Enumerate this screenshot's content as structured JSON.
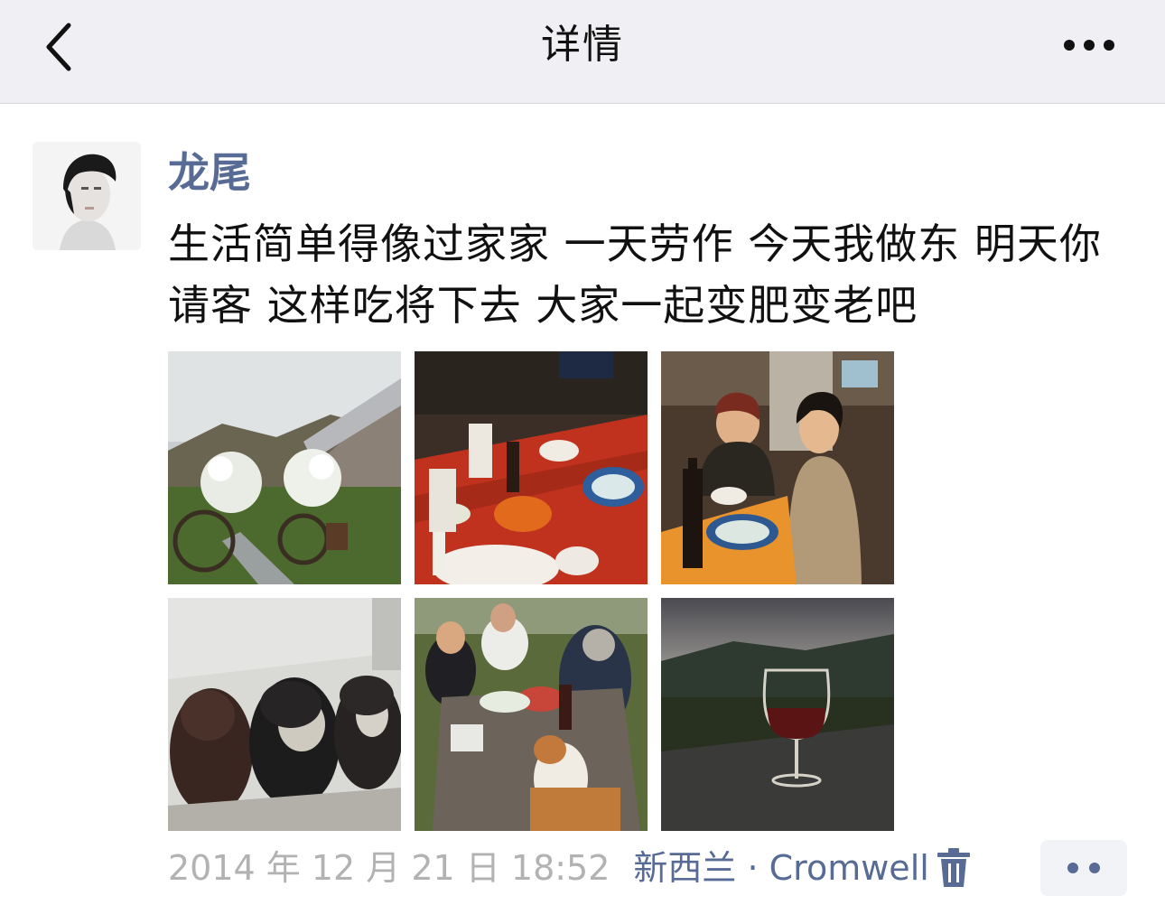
{
  "header": {
    "title": "详情",
    "back_icon": "chevron-left-icon",
    "more_icon": "more-dots-icon"
  },
  "post": {
    "author": "龙尾",
    "text": "生活简单得像过家家 一天劳作 今天我做东 明天你请客 这样吃将下去 大家一起变肥变老吧",
    "photos": [
      {
        "name": "photo-garden-house"
      },
      {
        "name": "photo-dinner-table"
      },
      {
        "name": "photo-friends-dinner"
      },
      {
        "name": "photo-dogs"
      },
      {
        "name": "photo-outdoor-lunch"
      },
      {
        "name": "photo-wine-glass-sunset"
      }
    ],
    "timestamp": "2014 年 12 月 21 日 18:52",
    "location": "新西兰 · Cromwell",
    "delete_icon": "trash-icon",
    "comment_icon": "comment-dots-icon"
  },
  "colors": {
    "nav_background": "#efeff4",
    "link_blue": "#576b95",
    "timestamp_gray": "#b2b2b2"
  }
}
